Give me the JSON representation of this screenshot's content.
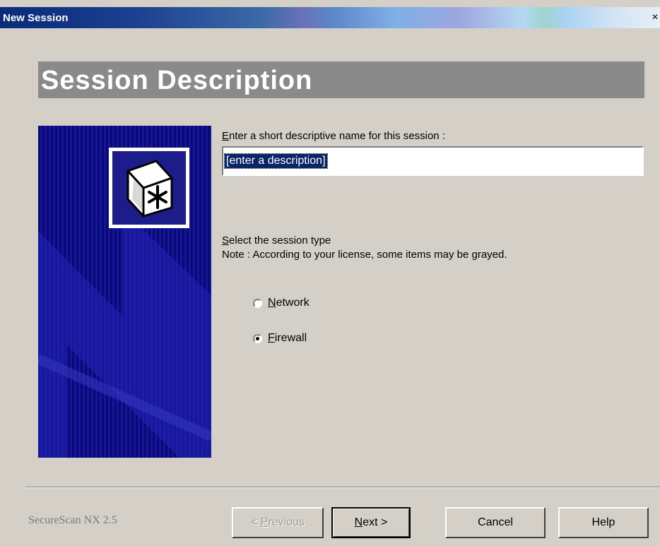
{
  "window": {
    "title": "New Session",
    "close_glyph": "×"
  },
  "heading": "Session Description",
  "description": {
    "prompt_mnemonic": "E",
    "prompt_rest": "nter a short descriptive name for this session :",
    "value": "[enter a description]"
  },
  "session_type": {
    "label_mnemonic": "S",
    "label_rest": "elect the session type",
    "note": "Note : According to your license, some items may be grayed.",
    "options": [
      {
        "mnemonic": "N",
        "rest": "etwork",
        "checked": false
      },
      {
        "mnemonic": "F",
        "rest": "irewall",
        "checked": true
      }
    ]
  },
  "footer": {
    "brand": "SecureScan NX 2.5",
    "buttons": {
      "previous": {
        "mnemonic": "P",
        "before": "< ",
        "rest": "revious",
        "enabled": false
      },
      "next": {
        "mnemonic": "N",
        "rest": "ext >",
        "enabled": true
      },
      "cancel": {
        "label": "Cancel"
      },
      "help": {
        "label": "Help"
      }
    }
  },
  "icons": {
    "logo": "snowflake-box-icon",
    "close": "close-icon"
  },
  "colors": {
    "banner_blue": "#0a0a6e",
    "heading_band": "#8a8a8a",
    "selection": "#0a246a"
  }
}
